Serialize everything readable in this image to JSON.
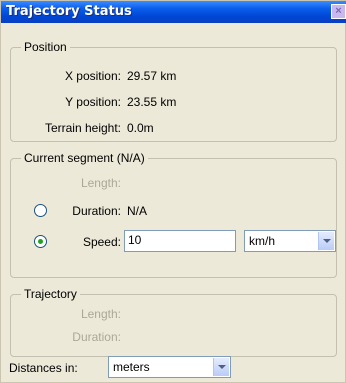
{
  "window": {
    "title": "Trajectory Status",
    "close_label": "×"
  },
  "position_group": {
    "title": "Position",
    "x_label": "X position:",
    "x_value": "29.57 km",
    "y_label": "Y position:",
    "y_value": "23.55 km",
    "terrain_label": "Terrain height:",
    "terrain_value": "0.0m"
  },
  "segment_group": {
    "title": "Current segment (N/A)",
    "length_label": "Length:",
    "duration_label": "Duration:",
    "duration_value": "N/A",
    "duration_selected": false,
    "speed_label": "Speed:",
    "speed_value": "10",
    "speed_selected": true,
    "speed_unit": "km/h"
  },
  "trajectory_group": {
    "title": "Trajectory",
    "length_label": "Length:",
    "duration_label": "Duration:"
  },
  "distances": {
    "label": "Distances in:",
    "unit": "meters"
  }
}
